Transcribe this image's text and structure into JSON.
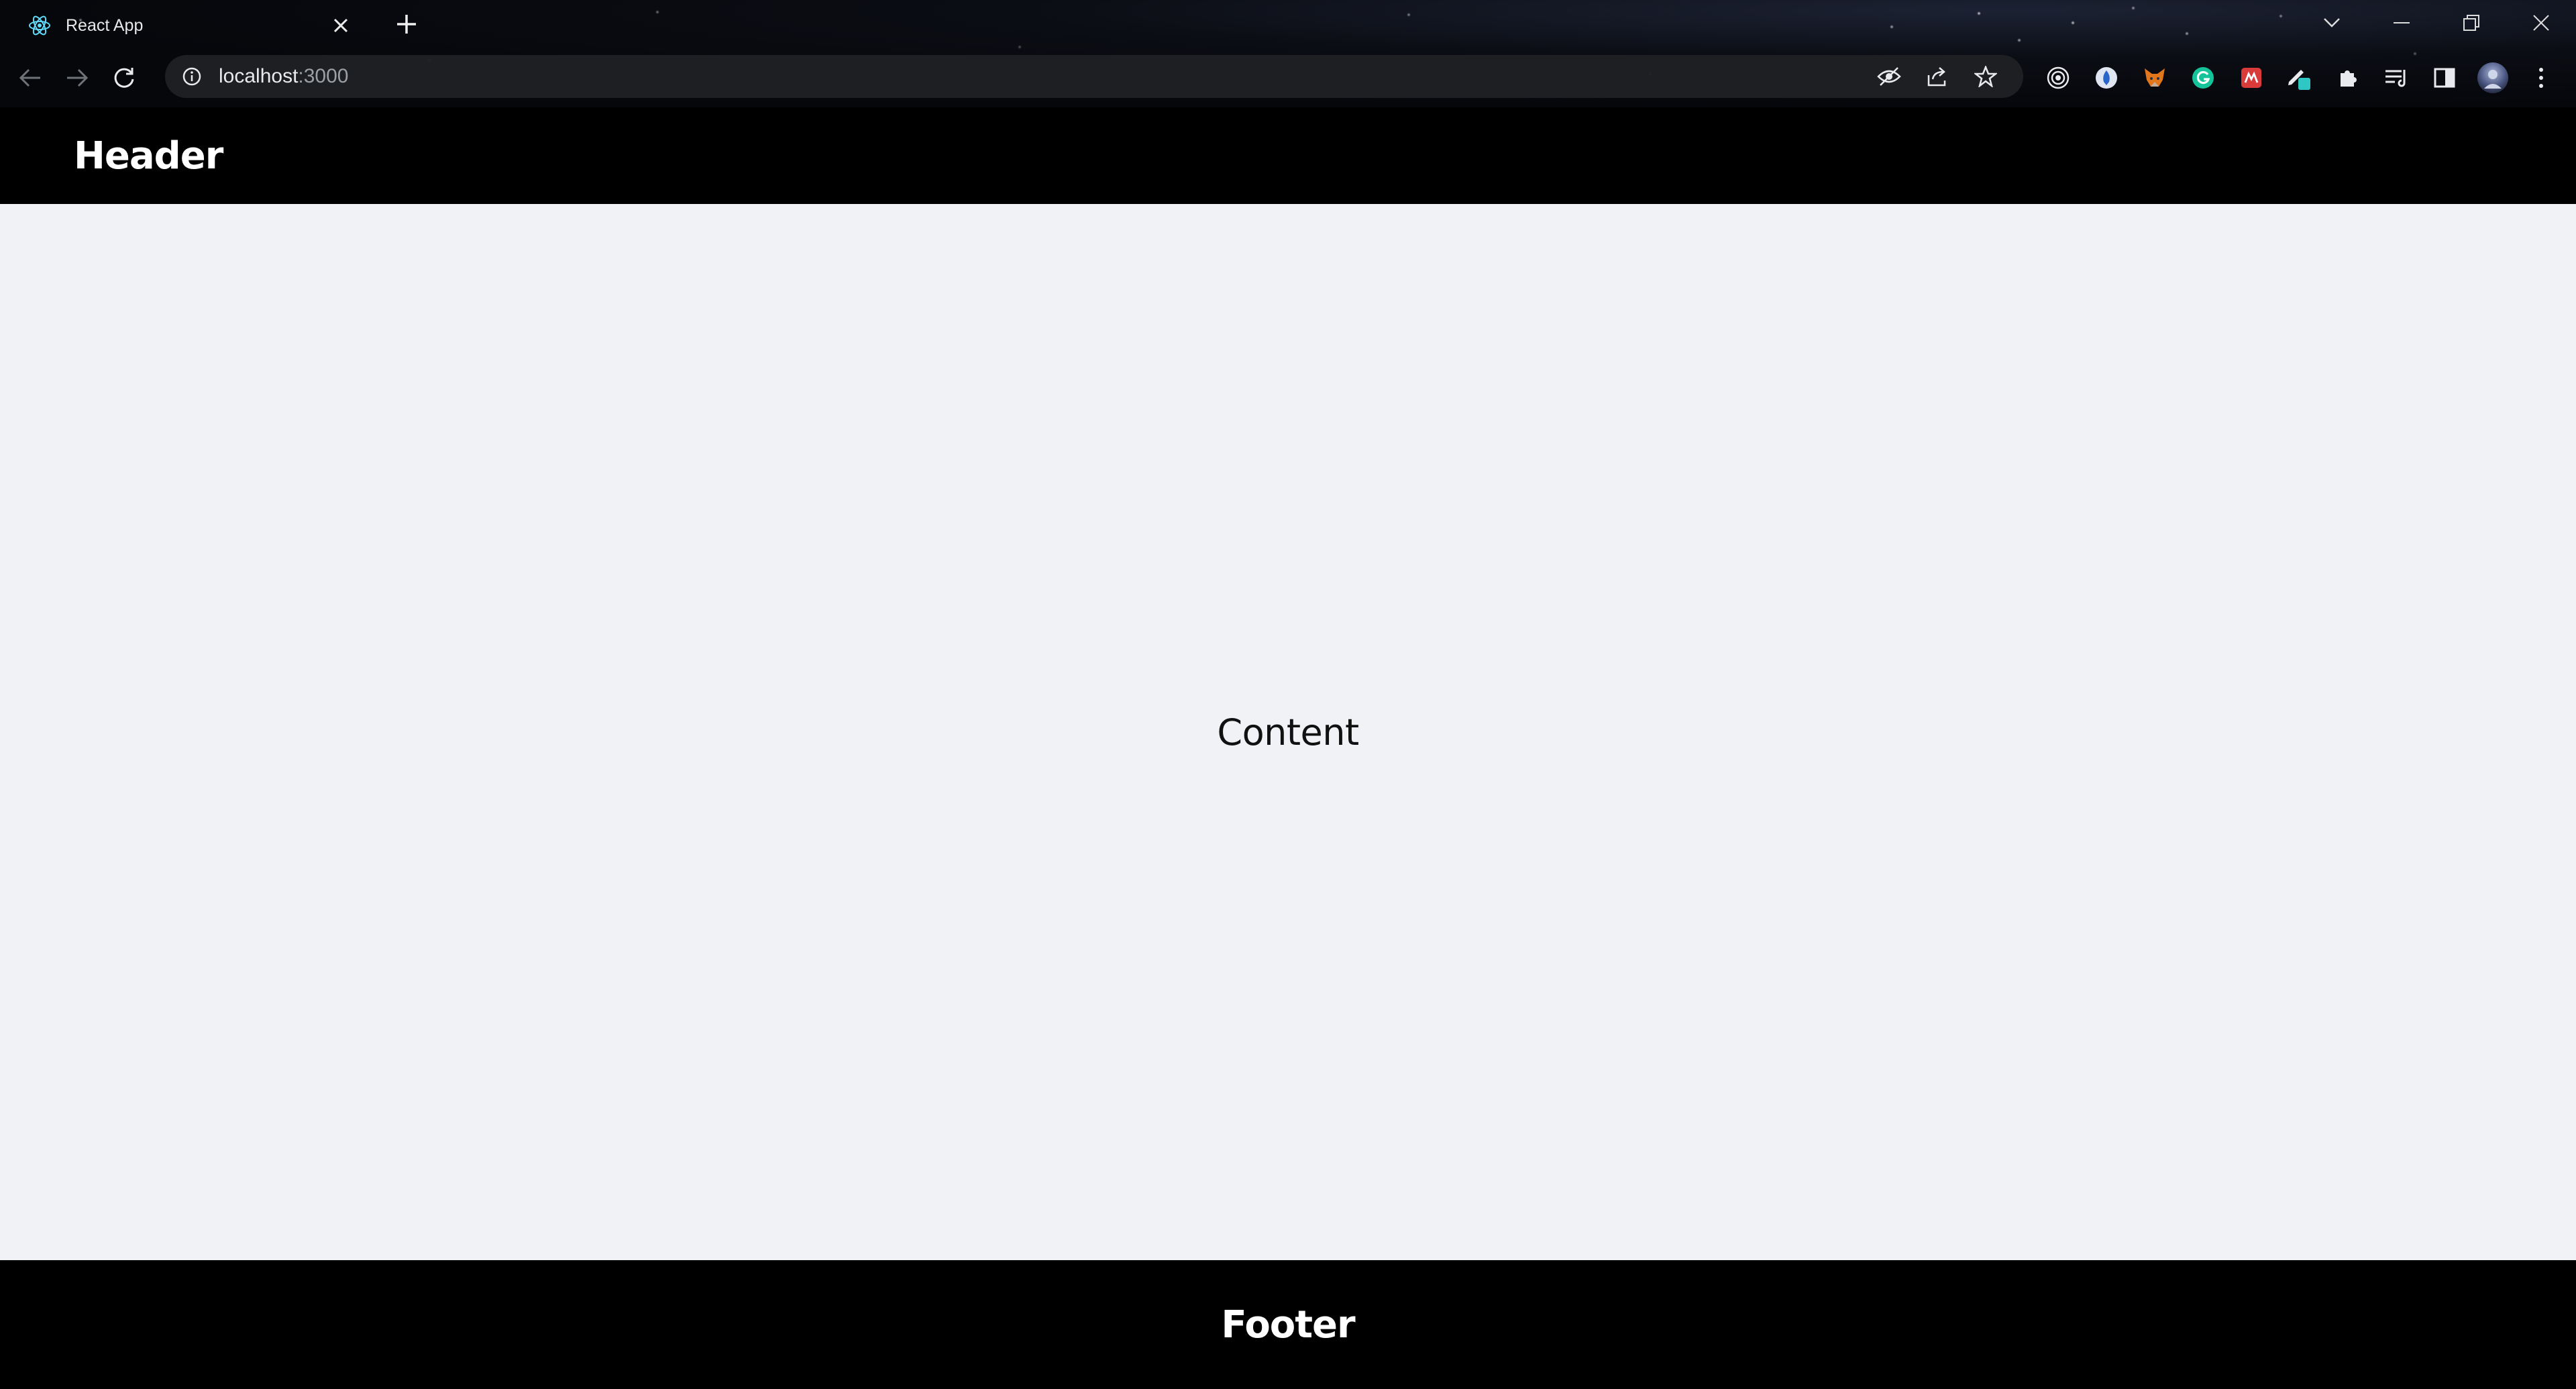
{
  "browser": {
    "tab": {
      "title": "React App",
      "favicon": "react-logo-icon",
      "close_icon": "close-icon"
    },
    "new_tab_icon": "plus-icon",
    "window_controls": [
      "chevron-down-icon",
      "minimize-icon",
      "restore-icon",
      "close-icon"
    ],
    "nav": [
      "back-arrow-icon",
      "forward-arrow-icon",
      "reload-icon"
    ],
    "address_bar": {
      "info_icon": "info-icon",
      "host": "localhost",
      "port": ":3000",
      "actions": [
        "eye-off-icon",
        "share-icon",
        "star-icon"
      ]
    },
    "extensions": [
      "target-icon",
      "shield-icon",
      "fox-icon",
      "grammarly-icon",
      "app-icon",
      "pen-icon",
      "puzzle-icon",
      "reading-list-icon",
      "side-panel-icon",
      "avatar",
      "kebab-menu-icon"
    ]
  },
  "app": {
    "header": "Header",
    "content": "Content",
    "footer": "Footer"
  },
  "colors": {
    "header_bg": "#000000",
    "content_bg": "#f0f2f5",
    "footer_bg": "#000000",
    "text_light": "#ffffff",
    "text_dark": "#111111",
    "react_blue": "#61dafb"
  }
}
